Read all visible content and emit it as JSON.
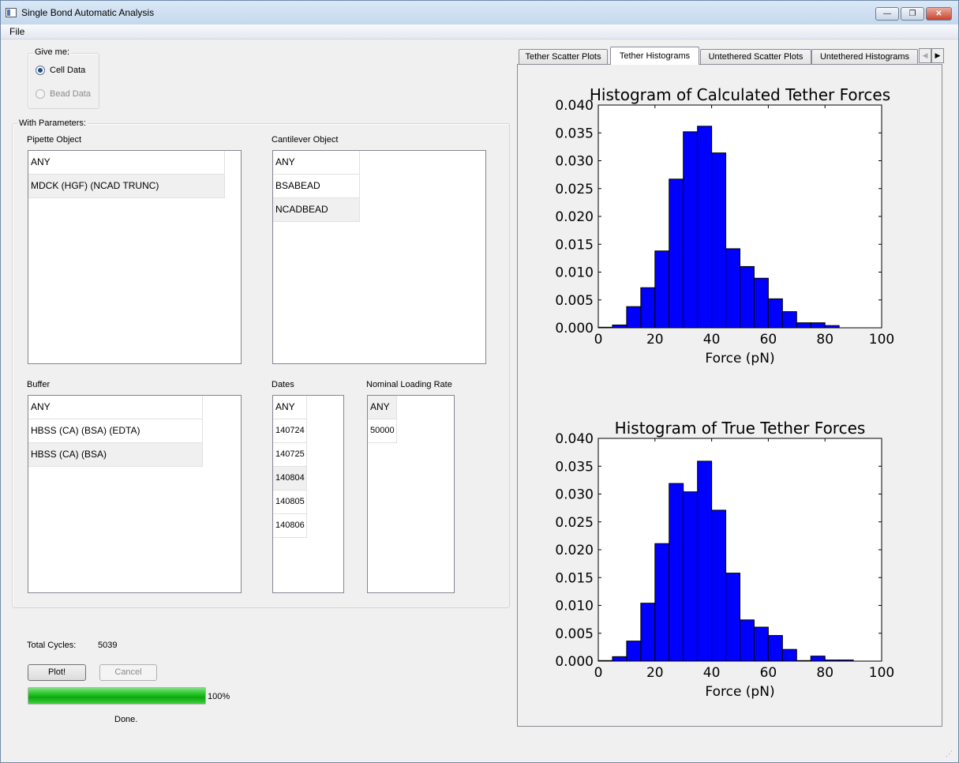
{
  "window": {
    "title": "Single Bond Automatic Analysis",
    "minimize": "—",
    "maximize": "❐",
    "close": "✕"
  },
  "menu": {
    "file": "File"
  },
  "give_me": {
    "label": "Give me:",
    "options": [
      {
        "label": "Cell Data",
        "checked": true,
        "enabled": true
      },
      {
        "label": "Bead Data",
        "checked": false,
        "enabled": false
      }
    ]
  },
  "parameters": {
    "label": "With Parameters:",
    "pipette": {
      "label": "Pipette Object",
      "items": [
        "ANY",
        "MDCK (HGF) (NCAD TRUNC)"
      ]
    },
    "cantilever": {
      "label": "Cantilever Object",
      "items": [
        "ANY",
        "BSABEAD",
        "NCADBEAD"
      ]
    },
    "buffer": {
      "label": "Buffer",
      "items": [
        "ANY",
        "HBSS (CA) (BSA) (EDTA)",
        "HBSS (CA) (BSA)"
      ]
    },
    "dates": {
      "label": "Dates",
      "items": [
        "ANY",
        "140724",
        "140725",
        "140804",
        "140805",
        "140806"
      ]
    },
    "loading_rate": {
      "label": "Nominal Loading Rate",
      "items": [
        "ANY",
        "50000"
      ]
    }
  },
  "status": {
    "total_cycles_label": "Total Cycles:",
    "total_cycles_value": "5039",
    "plot_button": "Plot!",
    "cancel_button": "Cancel",
    "progress_value": 100,
    "progress_text": "100%",
    "done_text": "Done."
  },
  "tabs": {
    "items": [
      "Tether Scatter Plots",
      "Tether Histograms",
      "Untethered Scatter Plots",
      "Untethered Histograms"
    ],
    "active": 1,
    "scroll_left": "◀",
    "scroll_right": "▶"
  },
  "chart_data": [
    {
      "type": "bar",
      "title": "Histogram of Calculated Tether Forces",
      "xlabel": "Force (pN)",
      "ylabel": "",
      "xlim": [
        0,
        100
      ],
      "ylim": [
        0,
        0.04
      ],
      "xticks": [
        0,
        20,
        40,
        60,
        80,
        100
      ],
      "yticks": [
        "0.000",
        "0.005",
        "0.010",
        "0.015",
        "0.020",
        "0.025",
        "0.030",
        "0.035",
        "0.040"
      ],
      "bin_edges": [
        0,
        5,
        10,
        15,
        20,
        25,
        30,
        35,
        40,
        45,
        50,
        55,
        60,
        65,
        70,
        75,
        80,
        85
      ],
      "values": [
        0.0001,
        0.0005,
        0.0038,
        0.0072,
        0.0138,
        0.0267,
        0.0352,
        0.0362,
        0.0314,
        0.0142,
        0.011,
        0.0089,
        0.0052,
        0.0029,
        0.0009,
        0.0009,
        0.0004
      ],
      "color": "#0000ff",
      "grid": false
    },
    {
      "type": "bar",
      "title": "Histogram of True Tether Forces",
      "xlabel": "Force (pN)",
      "ylabel": "",
      "xlim": [
        0,
        100
      ],
      "ylim": [
        0,
        0.04
      ],
      "xticks": [
        0,
        20,
        40,
        60,
        80,
        100
      ],
      "yticks": [
        "0.000",
        "0.005",
        "0.010",
        "0.015",
        "0.020",
        "0.025",
        "0.030",
        "0.035",
        "0.040"
      ],
      "bin_edges": [
        0,
        5,
        10,
        15,
        20,
        25,
        30,
        35,
        40,
        45,
        50,
        55,
        60,
        65,
        70,
        75,
        80,
        85,
        90
      ],
      "values": [
        0.0001,
        0.0008,
        0.0036,
        0.0104,
        0.0211,
        0.0319,
        0.0304,
        0.0359,
        0.0271,
        0.0158,
        0.0074,
        0.0061,
        0.0046,
        0.0021,
        0.0001,
        0.0009,
        0.0002,
        0.0002
      ],
      "color": "#0000ff",
      "grid": false
    }
  ]
}
